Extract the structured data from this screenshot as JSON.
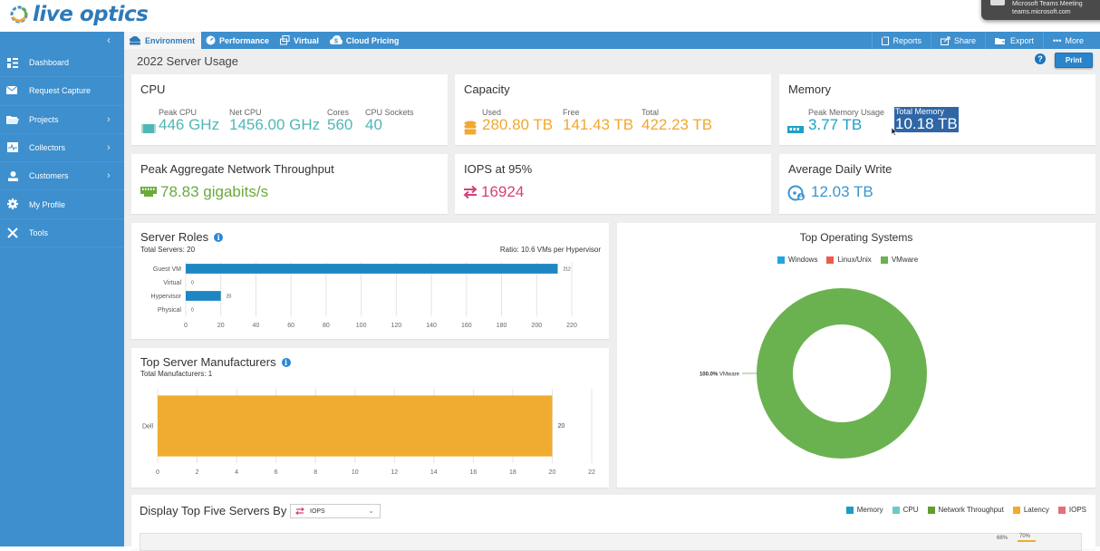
{
  "app": {
    "logo_text": "live optics"
  },
  "notification": {
    "line1": "Microsoft Teams Meeting",
    "line2": "teams.microsoft.com"
  },
  "tabs": [
    {
      "label": "Environment",
      "icon": "cloud-server-icon",
      "active": true
    },
    {
      "label": "Performance",
      "icon": "gauge-icon",
      "active": false
    },
    {
      "label": "Virtual",
      "icon": "virtual-icon",
      "active": false
    },
    {
      "label": "Cloud Pricing",
      "icon": "cloud-dollar-icon",
      "active": false
    }
  ],
  "actions": [
    {
      "label": "Reports",
      "icon": "report-icon"
    },
    {
      "label": "Share",
      "icon": "share-icon"
    },
    {
      "label": "Export",
      "icon": "export-icon"
    },
    {
      "label": "More",
      "icon": "more-icon"
    }
  ],
  "sidebar": {
    "items": [
      {
        "label": "Dashboard",
        "icon": "dashboard-icon",
        "has_submenu": false
      },
      {
        "label": "Request Capture",
        "icon": "mail-icon",
        "has_submenu": false
      },
      {
        "label": "Projects",
        "icon": "folder-icon",
        "has_submenu": true
      },
      {
        "label": "Collectors",
        "icon": "collector-icon",
        "has_submenu": true
      },
      {
        "label": "Customers",
        "icon": "user-icon",
        "has_submenu": true
      },
      {
        "label": "My Profile",
        "icon": "gear-icon",
        "has_submenu": false
      },
      {
        "label": "Tools",
        "icon": "tools-icon",
        "has_submenu": false
      }
    ]
  },
  "page": {
    "title": "2022 Server Usage",
    "help_label": "?",
    "print_label": "Print"
  },
  "cpu": {
    "title": "CPU",
    "color": "#4fb7b5",
    "metrics": [
      {
        "label": "Peak CPU",
        "value": "446 GHz"
      },
      {
        "label": "Net CPU",
        "value": "1456.00 GHz"
      },
      {
        "label": "Cores",
        "value": "560"
      },
      {
        "label": "CPU Sockets",
        "value": "40"
      }
    ]
  },
  "capacity": {
    "title": "Capacity",
    "color": "#f0a830",
    "metrics": [
      {
        "label": "Used",
        "value": "280.80 TB"
      },
      {
        "label": "Free",
        "value": "141.43 TB"
      },
      {
        "label": "Total",
        "value": "422.23 TB"
      }
    ]
  },
  "memory": {
    "title": "Memory",
    "color": "#1ea0c8",
    "metrics": [
      {
        "label": "Peak Memory Usage",
        "value": "3.77 TB"
      },
      {
        "label": "Total Memory",
        "value": "10.18 TB",
        "selected": true
      }
    ]
  },
  "network": {
    "title": "Peak Aggregate Network Throughput",
    "value": "78.83 gigabits/s",
    "color": "#6aab3a"
  },
  "iops": {
    "title": "IOPS at 95%",
    "value": "16924",
    "color": "#d6407a"
  },
  "daily_write": {
    "title": "Average Daily Write",
    "value": "12.03 TB",
    "color": "#3c95d0"
  },
  "server_roles": {
    "title": "Server Roles",
    "total": "Total Servers: 20",
    "ratio": "Ratio: 10.6 VMs per Hypervisor"
  },
  "manufacturers": {
    "title": "Top Server Manufacturers",
    "total": "Total Manufacturers: 1"
  },
  "os": {
    "title": "Top Operating Systems",
    "slice_label_pct": "100.0%",
    "slice_label_name": "VMware"
  },
  "top_five": {
    "title": "Display Top Five Servers By",
    "selected": "IOPS",
    "legend": [
      {
        "label": "Memory",
        "color": "#1d9cc4"
      },
      {
        "label": "CPU",
        "color": "#6ccac6"
      },
      {
        "label": "Network Throughput",
        "color": "#5f9f2c"
      },
      {
        "label": "Latency",
        "color": "#f0ac2a"
      },
      {
        "label": "IOPS",
        "color": "#e36f7a"
      }
    ],
    "visible_labels": [
      "68%",
      "70%"
    ]
  },
  "chart_data": [
    {
      "type": "bar",
      "orientation": "horizontal",
      "title": "Server Roles",
      "categories": [
        "Guest VM",
        "Virtual",
        "Hypervisor",
        "Physical"
      ],
      "values": [
        212,
        0,
        20,
        0
      ],
      "xticks": [
        0,
        20,
        40,
        60,
        80,
        100,
        120,
        140,
        160,
        180,
        200,
        220
      ],
      "xlim": [
        0,
        220
      ],
      "color": "#1f86c4",
      "grid": true
    },
    {
      "type": "bar",
      "orientation": "horizontal",
      "title": "Top Server Manufacturers",
      "categories": [
        "Dell"
      ],
      "values": [
        20
      ],
      "xticks": [
        0,
        2,
        4,
        6,
        8,
        10,
        12,
        14,
        16,
        18,
        20,
        22
      ],
      "xlim": [
        0,
        22
      ],
      "color": "#f0ac30",
      "grid": true
    },
    {
      "type": "pie",
      "donut": true,
      "title": "Top Operating Systems",
      "legend": [
        {
          "label": "Windows",
          "color": "#1ea7e0"
        },
        {
          "label": "Linux/Unix",
          "color": "#ef5b4b"
        },
        {
          "label": "VMware",
          "color": "#6ab24f"
        }
      ],
      "legend_position": "top-center",
      "slices": [
        {
          "label": "Windows",
          "value": 0
        },
        {
          "label": "Linux/Unix",
          "value": 0
        },
        {
          "label": "VMware",
          "value": 100.0
        }
      ]
    }
  ]
}
